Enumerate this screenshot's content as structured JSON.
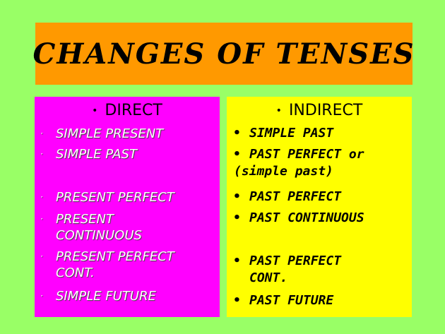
{
  "slide": {
    "title": "CHANGES OF TENSES",
    "colors": {
      "background": "#99ff66",
      "title_box": "#ff9900",
      "left_column": "#ff00ff",
      "right_column": "#ffff00"
    },
    "left": {
      "heading_bullet": "•",
      "heading": "DIRECT",
      "bullet": "·",
      "items": [
        {
          "line1": "SIMPLE PRESENT",
          "line2": ""
        },
        {
          "line1": "SIMPLE PAST",
          "line2": ""
        },
        {
          "line1": "PRESENT PERFECT",
          "line2": ""
        },
        {
          "line1": "PRESENT",
          "line2": "CONTINUOUS"
        },
        {
          "line1": "PRESENT PERFECT",
          "line2": "CONT."
        },
        {
          "line1": "SIMPLE FUTURE",
          "line2": ""
        }
      ]
    },
    "right": {
      "heading_bullet": "•",
      "heading": "INDIRECT",
      "bullet": "•",
      "items": [
        {
          "line1": "SIMPLE PAST",
          "line2": ""
        },
        {
          "line1": "PAST PERFECT or",
          "line2": "(simple past)"
        },
        {
          "line1": "PAST PERFECT",
          "line2": ""
        },
        {
          "line1": "PAST CONTINUOUS",
          "line2": ""
        },
        {
          "line1": "PAST PERFECT",
          "line2": "CONT."
        },
        {
          "line1": "PAST FUTURE",
          "line2": ""
        }
      ]
    }
  }
}
